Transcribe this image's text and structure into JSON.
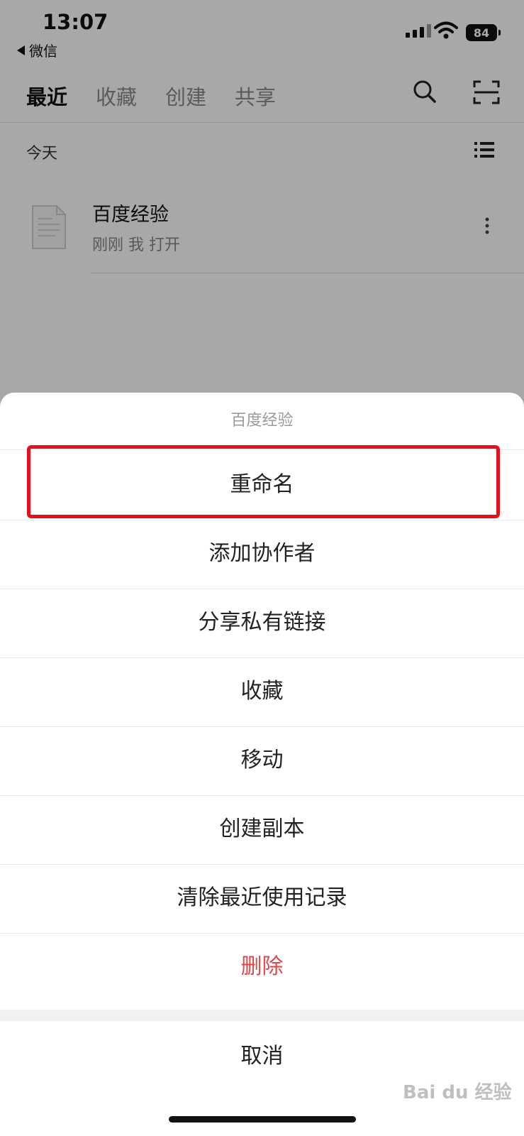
{
  "status_bar": {
    "time": "13:07",
    "back_label": "微信",
    "battery": "84"
  },
  "tabs": [
    {
      "label": "最近",
      "active": true
    },
    {
      "label": "收藏",
      "active": false
    },
    {
      "label": "创建",
      "active": false
    },
    {
      "label": "共享",
      "active": false
    }
  ],
  "section": {
    "label": "今天"
  },
  "file": {
    "name": "百度经验",
    "meta": "刚刚 我 打开"
  },
  "sheet": {
    "title": "百度经验",
    "items": [
      {
        "label": "重命名"
      },
      {
        "label": "添加协作者"
      },
      {
        "label": "分享私有链接"
      },
      {
        "label": "收藏"
      },
      {
        "label": "移动"
      },
      {
        "label": "创建副本"
      },
      {
        "label": "清除最近使用记录"
      },
      {
        "label": "删除"
      }
    ],
    "cancel": "取消"
  },
  "watermark": "Bai du 经验",
  "colors": {
    "highlight": "#e5101c",
    "danger": "#e0474b",
    "scrim": "rgba(0,0,0,0.34)"
  }
}
